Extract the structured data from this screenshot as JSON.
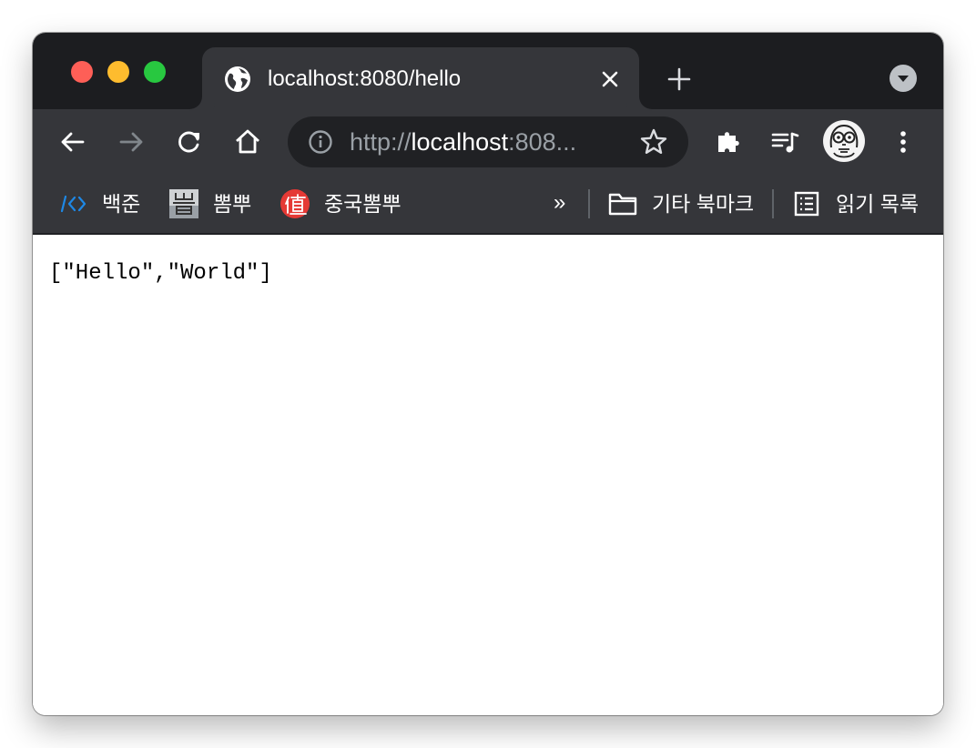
{
  "tab": {
    "title": "localhost:8080/hello",
    "favicon": "globe-icon"
  },
  "omnibox": {
    "scheme": "http://",
    "host": "localhost",
    "rest": ":808..."
  },
  "bookmarks": {
    "items": [
      {
        "label": "백준",
        "icon": "code-brackets-icon"
      },
      {
        "label": "뽐뿌",
        "icon": "ppomppu-icon"
      },
      {
        "label": "중국뽐뿌",
        "icon": "zhi-icon",
        "icon_text": "值"
      }
    ],
    "overflow": "»",
    "other_bookmarks": "기타 북마크",
    "reading_list": "읽기 목록"
  },
  "page": {
    "content": "[\"Hello\",\"World\"]"
  },
  "colors": {
    "titlebar": "#1c1d20",
    "toolbar": "#35363a",
    "omnibox": "#202124",
    "traffic_close": "#fe5f57",
    "traffic_min": "#febc2e",
    "traffic_max": "#28c840"
  }
}
